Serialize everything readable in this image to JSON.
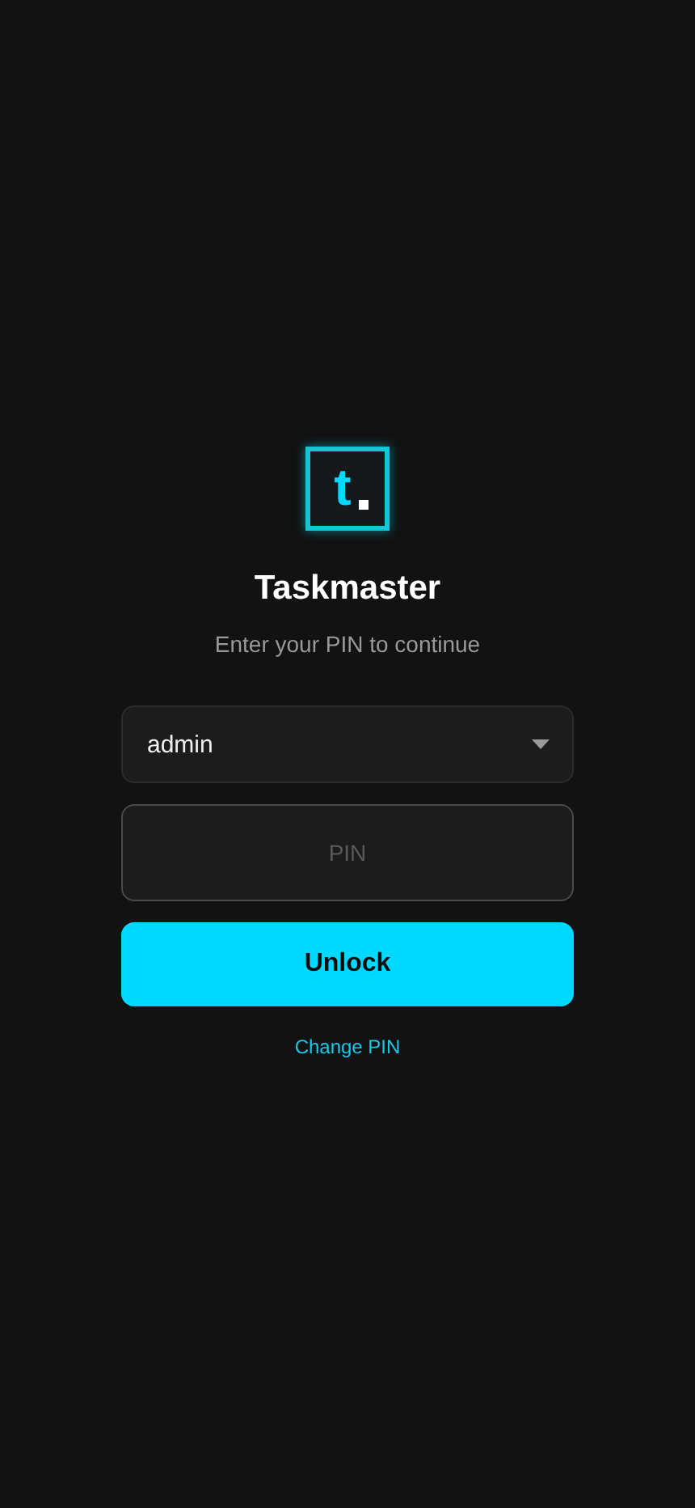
{
  "logo": {
    "letter": "t"
  },
  "title": "Taskmaster",
  "subtitle": "Enter your PIN to continue",
  "user_select": {
    "value": "admin"
  },
  "pin_field": {
    "placeholder": "PIN"
  },
  "unlock_button": "Unlock",
  "change_pin_link": "Change PIN"
}
